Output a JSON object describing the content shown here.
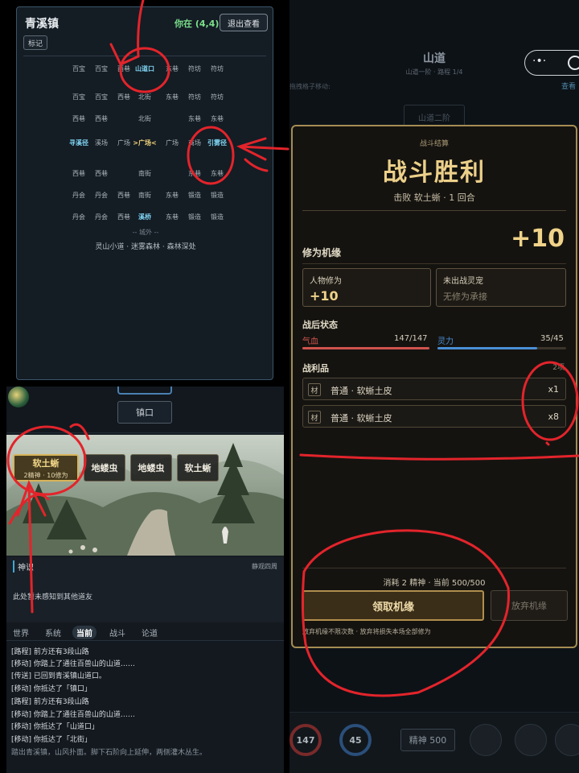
{
  "map": {
    "title": "青溪镇",
    "position": "你在 (4,4)",
    "exit_button": "退出查看",
    "mark_button": "标记",
    "rows": [
      [
        "百宝",
        "百宝",
        "西巷",
        "山道口",
        "东巷",
        "符坊",
        "符坊"
      ],
      [
        "百宝",
        "百宝",
        "西巷",
        "北街",
        "东巷",
        "符坊",
        "符坊"
      ],
      [
        "西巷",
        "西巷",
        "",
        "北街",
        "",
        "东巷",
        "东巷"
      ],
      [
        "寻溪径",
        "溪场",
        "广场",
        ">广场<",
        "广场",
        "商场",
        "引雾径"
      ],
      [
        "西巷",
        "西巷",
        "",
        "南街",
        "",
        "东巷",
        "东巷"
      ],
      [
        "丹会",
        "丹会",
        "西巷",
        "南街",
        "东巷",
        "锻造",
        "锻造"
      ],
      [
        "丹会",
        "丹会",
        "西巷",
        "溪桥",
        "东巷",
        "锻造",
        "锻造"
      ]
    ],
    "outside_label": "-- 城外 --",
    "outside_places": "灵山小道 · 迷雾森林 · 森林深处"
  },
  "game": {
    "town_node": "镇口",
    "enemies": [
      {
        "name": "软土蜥",
        "detail": "2精神 · 10修为",
        "selected": true
      },
      {
        "name": "地蝼虫",
        "detail": "",
        "selected": false
      },
      {
        "name": "地蝼虫",
        "detail": "",
        "selected": false
      },
      {
        "name": "软土蜥",
        "detail": "",
        "selected": false
      }
    ],
    "sense_title": "神识",
    "sense_right": "静观四周",
    "sense_text": "此处暂未感知到其他道友",
    "tabs": [
      "世界",
      "系统",
      "当前",
      "战斗",
      "论道"
    ],
    "active_tab": "当前",
    "log": [
      "[路程] 前方还有3段山路",
      "[移动] 你踏上了通往百兽山的山道……",
      "[传送] 已回到青溪镇山道口。",
      "[移动] 你抵达了「镇口」",
      "[路程] 前方还有3段山路",
      "[移动] 你踏上了通往百兽山的山道……",
      "[移动] 你抵达了「山道口」",
      "[移动] 你抵达了「北街」",
      "踏出青溪镇，山风扑面。脚下石阶向上延伸，两侧灌木丛生。"
    ]
  },
  "right": {
    "title": "山道",
    "subtitle": "山道一阶 · 路程 1/4",
    "hint": "拖拽格子移动:",
    "look": "查看",
    "next_node": "山道二阶",
    "capsule_dots": "·•·",
    "hud": {
      "hp": "147",
      "mp": "45",
      "spirit": "精神 500"
    }
  },
  "modal": {
    "header": "战斗结算",
    "title": "战斗胜利",
    "subtitle": "击败 软土蜥 · 1 回合",
    "gain_label": "修为机缘",
    "gain_value": "+10",
    "char_label": "人物修为",
    "char_value": "+10",
    "pet_label": "未出战灵宠",
    "pet_value": "无修为承接",
    "after_label": "战后状态",
    "hp_label": "气血",
    "hp_value": "147/147",
    "hp_fraction": 1.0,
    "mp_label": "灵力",
    "mp_value": "35/45",
    "mp_fraction": 0.778,
    "loot_label": "战利品",
    "loot_count": "2项",
    "loot": [
      {
        "tag": "材",
        "name": "普通 · 软蜥土皮",
        "qty": "x1"
      },
      {
        "tag": "材",
        "name": "普通 · 软蜥土皮",
        "qty": "x8"
      }
    ],
    "cost": "消耗 2 精神 · 当前 500/500",
    "claim_button": "领取机缘",
    "forfeit_button": "放弃机缘",
    "note": "放弃机缘不限次数 · 放弃将损失本场全部修为"
  },
  "colors": {
    "accent_gold": "#f0d38a",
    "hp_red": "#d0544e",
    "mp_blue": "#4a8fd6",
    "annotation_red": "#e3242b"
  }
}
